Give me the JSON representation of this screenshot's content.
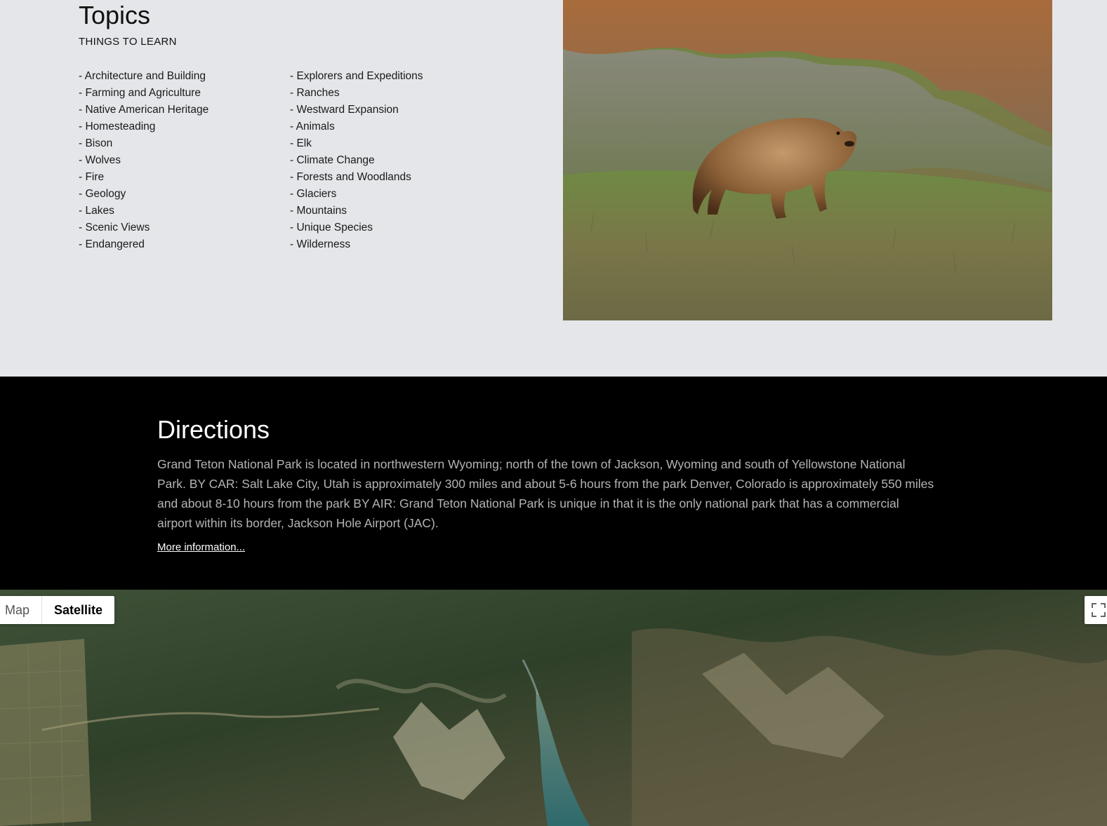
{
  "topics": {
    "title": "Topics",
    "subtitle": "THINGS TO LEARN",
    "left_items": [
      "- Architecture and Building",
      "- Farming and Agriculture",
      "- Native American Heritage",
      "- Homesteading",
      "- Bison",
      "- Wolves",
      "- Fire",
      "- Geology",
      "- Lakes",
      "- Scenic Views",
      "- Endangered"
    ],
    "right_items": [
      "- Explorers and Expeditions",
      "- Ranches",
      "- Westward Expansion",
      "- Animals",
      "- Elk",
      "- Climate Change",
      "- Forests and Woodlands",
      "- Glaciers",
      "- Mountains",
      "- Unique Species",
      "- Wilderness"
    ]
  },
  "directions": {
    "title": "Directions",
    "text": "Grand Teton National Park is located in northwestern Wyoming; north of the town of Jackson, Wyoming and south of Yellowstone National Park. BY CAR: Salt Lake City, Utah is approximately 300 miles and about 5-6 hours from the park Denver, Colorado is approximately 550 miles and about 8-10 hours from the park BY AIR: Grand Teton National Park is unique in that it is the only national park that has a commercial airport within its border, Jackson Hole Airport (JAC).",
    "more_link": "More information..."
  },
  "map": {
    "map_label": "Map",
    "satellite_label": "Satellite",
    "selected": "Satellite",
    "fullscreen_icon": "fullscreen-icon"
  }
}
